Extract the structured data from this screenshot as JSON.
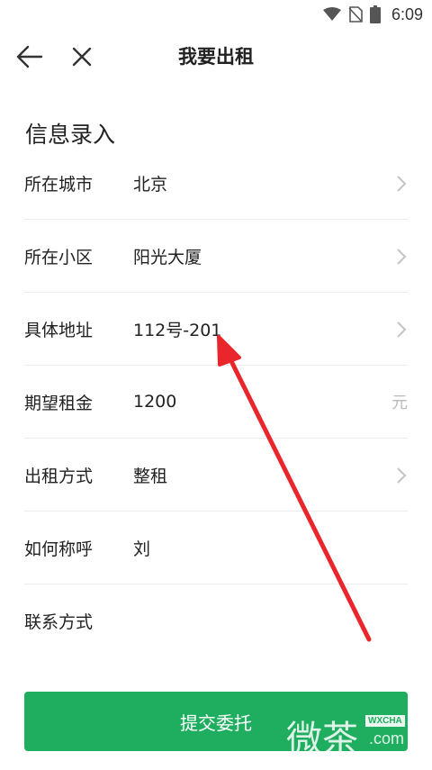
{
  "status_bar": {
    "time": "6:09",
    "icons": [
      "wifi-icon",
      "no-sim-icon",
      "battery-icon"
    ]
  },
  "toolbar": {
    "title": "我要出租",
    "back_icon": "arrow-left-icon",
    "close_icon": "close-icon"
  },
  "section": {
    "title": "信息录入"
  },
  "form": {
    "rows": [
      {
        "label": "所在城市",
        "value": "北京",
        "trailing": "chevron-right-icon"
      },
      {
        "label": "所在小区",
        "value": "阳光大厦",
        "trailing": "chevron-right-icon"
      },
      {
        "label": "具体地址",
        "value": "112号-201",
        "trailing": "chevron-right-icon"
      },
      {
        "label": "期望租金",
        "value": "1200",
        "suffix": "元"
      },
      {
        "label": "出租方式",
        "value": "整租",
        "trailing": "chevron-right-icon"
      },
      {
        "label": "如何称呼",
        "value": "刘"
      },
      {
        "label": "联系方式",
        "value": ""
      }
    ]
  },
  "submit": {
    "label": "提交委托"
  },
  "watermark": {
    "text": "微茶",
    "badge": "WXCHA",
    "domain": ".com"
  },
  "colors": {
    "primary": "#1fad5f",
    "annotation_arrow": "#e8262c",
    "divider": "#ececec",
    "muted": "#bbbbbb"
  }
}
